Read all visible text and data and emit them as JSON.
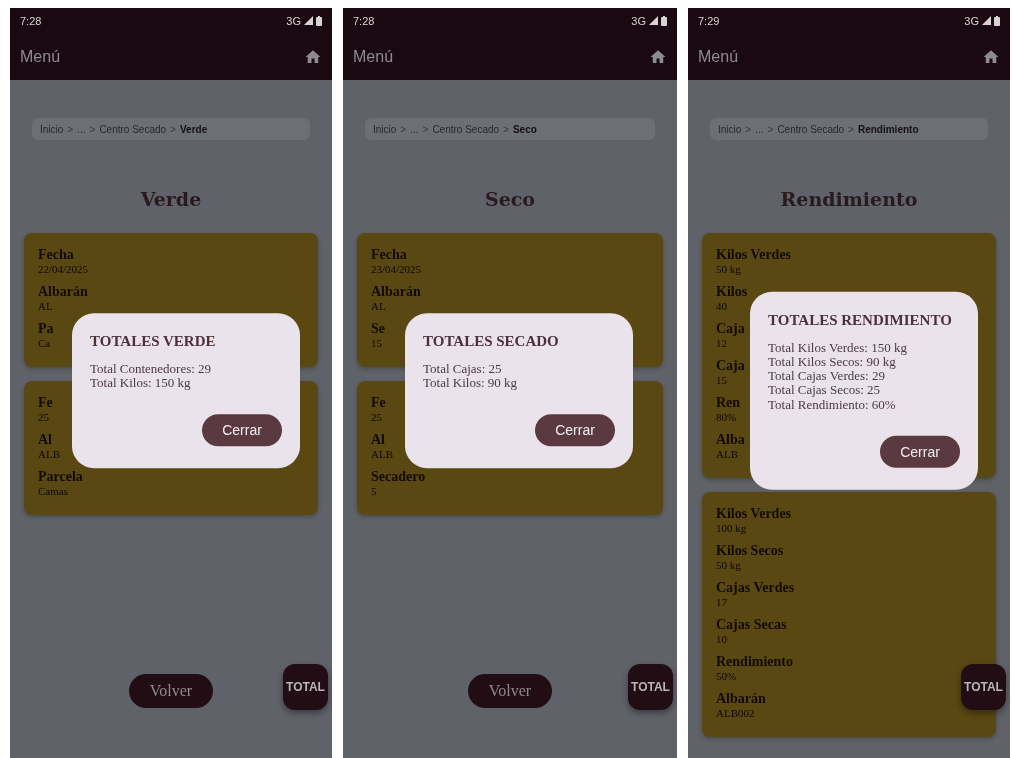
{
  "screens": [
    {
      "status_bar": {
        "time": "7:28",
        "network": "3G"
      },
      "app_bar": {
        "title": "Menú"
      },
      "breadcrumb": {
        "separator": ">",
        "items": [
          {
            "label": "Inicio",
            "current": false
          },
          {
            "label": "...",
            "current": false
          },
          {
            "label": "Centro Secado",
            "current": false
          },
          {
            "label": "Verde",
            "current": true
          }
        ]
      },
      "title": "Verde",
      "cards": [
        {
          "fields": [
            {
              "label": "Fecha",
              "value": "22/04/2025"
            },
            {
              "label": "Albarán",
              "value": "AL"
            },
            {
              "label": "Pa",
              "value": "Ca"
            }
          ]
        },
        {
          "fields": [
            {
              "label": "Fe",
              "value": "25"
            },
            {
              "label": "Al",
              "value": "ALB"
            },
            {
              "label": "Parcela",
              "value": "Camas"
            }
          ]
        }
      ],
      "back_button": "Volver",
      "fab": "TOTAL",
      "dialog": {
        "title": "TOTALES VERDE",
        "lines": [
          "Total Contenedores: 29",
          "Total Kilos: 150 kg"
        ],
        "button": "Cerrar"
      }
    },
    {
      "status_bar": {
        "time": "7:28",
        "network": "3G"
      },
      "app_bar": {
        "title": "Menú"
      },
      "breadcrumb": {
        "separator": ">",
        "items": [
          {
            "label": "Inicio",
            "current": false
          },
          {
            "label": "...",
            "current": false
          },
          {
            "label": "Centro Secado",
            "current": false
          },
          {
            "label": "Seco",
            "current": true
          }
        ]
      },
      "title": "Seco",
      "cards": [
        {
          "fields": [
            {
              "label": "Fecha",
              "value": "23/04/2025"
            },
            {
              "label": "Albarán",
              "value": "AL"
            },
            {
              "label": "Se",
              "value": "15"
            }
          ]
        },
        {
          "fields": [
            {
              "label": "Fe",
              "value": "25"
            },
            {
              "label": "Al",
              "value": "ALB"
            },
            {
              "label": "Secadero",
              "value": "5"
            }
          ]
        }
      ],
      "back_button": "Volver",
      "fab": "TOTAL",
      "dialog": {
        "title": "TOTALES SECADO",
        "lines": [
          "Total Cajas: 25",
          "Total Kilos: 90 kg"
        ],
        "button": "Cerrar"
      }
    },
    {
      "status_bar": {
        "time": "7:29",
        "network": "3G"
      },
      "app_bar": {
        "title": "Menú"
      },
      "breadcrumb": {
        "separator": ">",
        "items": [
          {
            "label": "Inicio",
            "current": false
          },
          {
            "label": "...",
            "current": false
          },
          {
            "label": "Centro Secado",
            "current": false
          },
          {
            "label": "Rendimiento",
            "current": true
          }
        ]
      },
      "title": "Rendimiento",
      "cards": [
        {
          "fields": [
            {
              "label": "Kilos Verdes",
              "value": "50 kg"
            },
            {
              "label": "Kilos",
              "value": "40"
            },
            {
              "label": "Caja",
              "value": "12"
            },
            {
              "label": "Caja",
              "value": "15"
            },
            {
              "label": "Ren",
              "value": "80%"
            },
            {
              "label": "Alba",
              "value": "ALB"
            }
          ]
        },
        {
          "fields": [
            {
              "label": "Kilos Verdes",
              "value": "100 kg"
            },
            {
              "label": "Kilos Secos",
              "value": "50 kg"
            },
            {
              "label": "Cajas Verdes",
              "value": "17"
            },
            {
              "label": "Cajas Secas",
              "value": "10"
            },
            {
              "label": "Rendimiento",
              "value": "50%"
            },
            {
              "label": "Albarán",
              "value": "ALB002"
            }
          ]
        }
      ],
      "fab": "TOTAL",
      "dialog": {
        "title": "TOTALES RENDIMIENTO",
        "lines": [
          "Total Kilos Verdes: 150 kg",
          "Total Kilos Secos: 90 kg",
          "Total Cajas Verdes: 29",
          "Total Cajas Secos: 25",
          "Total Rendimiento: 60%"
        ],
        "button": "Cerrar"
      }
    }
  ]
}
